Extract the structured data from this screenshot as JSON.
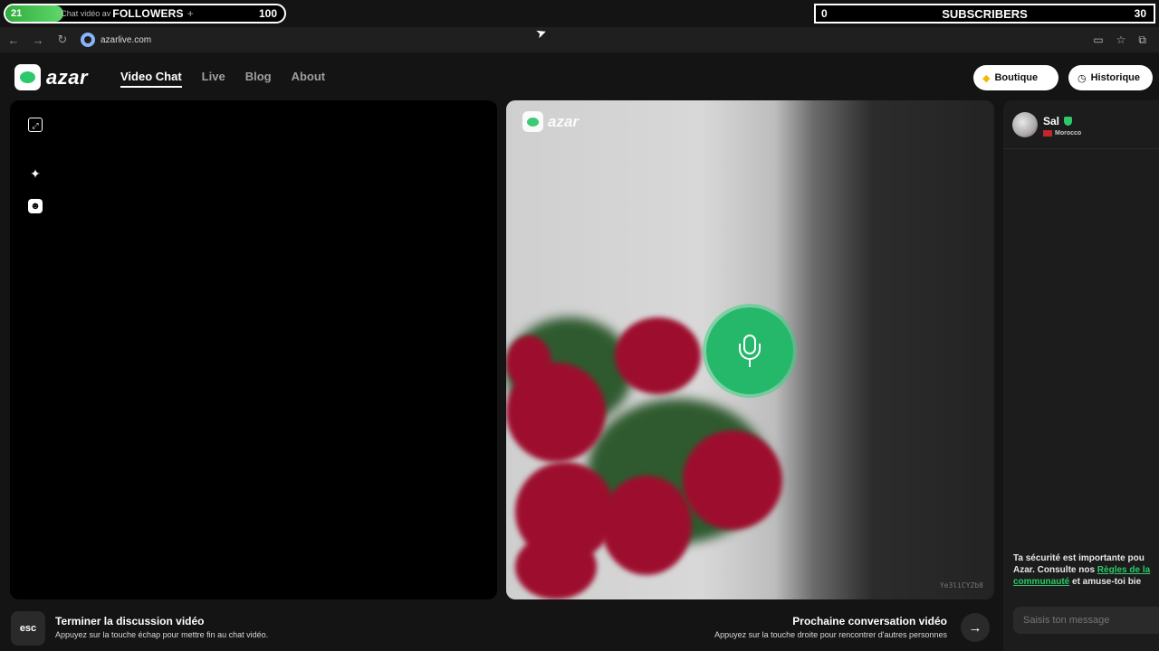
{
  "overlay": {
    "followers": {
      "current": "21",
      "prefix": ": Chat vidéo av",
      "label": "FOLLOWERS",
      "plus": "+",
      "goal": "100",
      "progress": 0.21
    },
    "subscribers": {
      "current": "0",
      "label": "SUBSCRIBERS",
      "goal": "30"
    }
  },
  "browser": {
    "url": "azarlive.com",
    "back_icon": "←",
    "forward_icon": "→",
    "reload_icon": "↻",
    "cast_icon": "▭",
    "star_icon": "☆",
    "extensions_icon": "⧉",
    "cursor_icon": "➤"
  },
  "header": {
    "logo_text": "azar",
    "nav": [
      {
        "label": "Video Chat",
        "active": true
      },
      {
        "label": "Live"
      },
      {
        "label": "Blog"
      },
      {
        "label": "About"
      }
    ],
    "boutique_label": "Boutique",
    "boutique_icon": "◆",
    "historique_label": "Historique",
    "historique_icon": "◷"
  },
  "local_panel": {
    "expand_icon": "⤢",
    "sparkle_icon": "✦",
    "sticker_icon": "☻"
  },
  "remote_panel": {
    "logo_text": "azar",
    "session_id": "Ye3liCYZb8"
  },
  "chat": {
    "peer_name": "Sal",
    "peer_country": "Morocco",
    "safety_line1": "Ta sécurité est importante pou",
    "safety_line2_prefix": "Azar. Consulte nos ",
    "safety_link1": "Règles de la",
    "safety_link2": "communauté",
    "safety_line3_suffix": " et amuse-toi bie",
    "input_placeholder": "Saisis ton message"
  },
  "bottom": {
    "esc_label": "esc",
    "end_title": "Terminer la discussion vidéo",
    "end_desc": "Appuyez sur la touche échap pour mettre fin au chat vidéo.",
    "next_title": "Prochaine conversation vidéo",
    "next_desc": "Appuyez sur la touche droite pour rencontrer d'autres personnes",
    "next_icon": "→"
  },
  "colors": {
    "accent": "#2cc96b",
    "background": "#141414",
    "mic_green": "#25b86a"
  }
}
